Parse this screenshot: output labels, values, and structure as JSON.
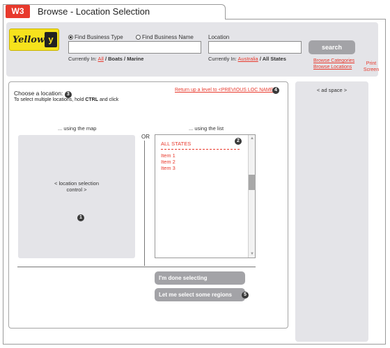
{
  "window": {
    "badge": "W3",
    "title": "Browse - Location Selection"
  },
  "logo": {
    "text": "Yellow",
    "mark": "y"
  },
  "search": {
    "type_radio_label": "Find Business Type",
    "name_radio_label": "Find Business Name",
    "location_label": "Location",
    "currently_in_prefix": "Currently In:",
    "type_path_link": "All",
    "type_path_rest": "/ Boats / Marine",
    "location_path_link": "Australia",
    "location_path_rest": "/ All States",
    "search_button": "search",
    "browse_categories": "Browse Categories",
    "browse_locations": "Browse Locations",
    "print_screen": "Print Screen"
  },
  "content": {
    "heading": "Choose a location:",
    "instruction_pre": "To select multiple locations, hold ",
    "instruction_key": "CTRL",
    "instruction_post": " and click",
    "return_link": "Return up a level to <PREVIOUS LOC NAME>",
    "map_label": "... using the map",
    "or_label": "OR",
    "list_label": "... using the list",
    "map_placeholder_line1": "< location selection",
    "map_placeholder_line2": "control >",
    "list_header": "ALL STATES",
    "list_items": [
      "Item 1",
      "Item 2",
      "Item 3"
    ],
    "done_button": "I'm done selecting",
    "regions_button": "Let me select some regions"
  },
  "badges": {
    "n1": "1",
    "n2": "2",
    "n3": "3",
    "n4": "4",
    "n5": "5"
  },
  "ad": {
    "text": "< ad space >"
  },
  "colors": {
    "accent_red": "#e8392c",
    "panel_gray": "#e4e4e8",
    "button_gray": "#a3a3a7",
    "logo_yellow": "#f6e21c"
  }
}
